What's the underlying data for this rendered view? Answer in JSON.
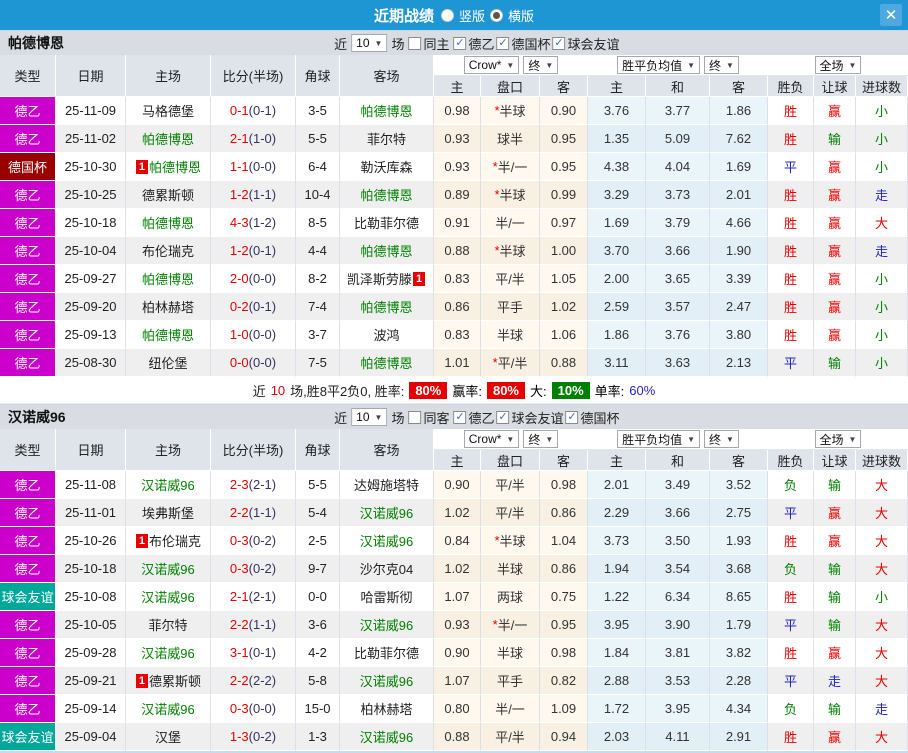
{
  "titlebar": {
    "title": "近期战绩",
    "vertical_label": "竖版",
    "horizontal_label": "横版",
    "horizontal_selected": true,
    "close_label": "✕"
  },
  "colors": {
    "accent_blue": "#1E96D3",
    "league": {
      "德乙": "#CC00CC",
      "德国杯": "#990000",
      "球会友谊": "#00A79B"
    },
    "outcome": {
      "胜": "#E60000",
      "平": "#2222CC",
      "负": "#008000",
      "赢": "#E60000",
      "输": "#008000",
      "走": "#2222CC",
      "大": "#E60000",
      "小": "#008000"
    },
    "self_team_green": "#008000",
    "score_red": "#E60000"
  },
  "header": {
    "type": "类型",
    "date": "日期",
    "home": "主场",
    "score": "比分(半场)",
    "corner": "角球",
    "away": "客场",
    "bookmaker_select": "Crow*",
    "odds_final_select": "终",
    "avg_select": "胜平负均值",
    "avg_final_select": "终",
    "scope_select": "全场",
    "sub": {
      "h": "主",
      "handicap": "盘口",
      "a": "客",
      "avg_h": "主",
      "avg_d": "和",
      "avg_a": "客",
      "wl": "胜负",
      "ah": "让球",
      "goals": "进球数"
    }
  },
  "sections": [
    {
      "team": "帕德博恩",
      "near_label": "近",
      "count_value": "10",
      "games_label": "场",
      "same_label": "同主",
      "same_checked": false,
      "filters": [
        {
          "label": "德乙",
          "checked": true
        },
        {
          "label": "德国杯",
          "checked": true
        },
        {
          "label": "球会友谊",
          "checked": true
        }
      ],
      "rows": [
        {
          "league": "德乙",
          "date": "25-11-09",
          "home": {
            "name": "马格德堡"
          },
          "score": "0-1",
          "half": "(0-1)",
          "corner": "3-5",
          "away": {
            "name": "帕德博恩",
            "self": true
          },
          "odds": [
            "0.98",
            "*半球",
            "0.90"
          ],
          "avg": [
            "3.76",
            "3.77",
            "1.86"
          ],
          "res": [
            "胜",
            "赢",
            "小"
          ]
        },
        {
          "league": "德乙",
          "date": "25-11-02",
          "home": {
            "name": "帕德博恩",
            "self": true
          },
          "score": "2-1",
          "half": "(1-0)",
          "corner": "5-5",
          "away": {
            "name": "菲尔特"
          },
          "odds": [
            "0.93",
            "球半",
            "0.95"
          ],
          "avg": [
            "1.35",
            "5.09",
            "7.62"
          ],
          "res": [
            "胜",
            "输",
            "小"
          ]
        },
        {
          "league": "德国杯",
          "date": "25-10-30",
          "home": {
            "name": "帕德博恩",
            "self": true,
            "badge": "1"
          },
          "score": "1-1",
          "half": "(0-0)",
          "corner": "6-4",
          "away": {
            "name": "勒沃库森"
          },
          "odds": [
            "0.93",
            "*半/一",
            "0.95"
          ],
          "avg": [
            "4.38",
            "4.04",
            "1.69"
          ],
          "res": [
            "平",
            "赢",
            "小"
          ]
        },
        {
          "league": "德乙",
          "date": "25-10-25",
          "home": {
            "name": "德累斯顿"
          },
          "score": "1-2",
          "half": "(1-1)",
          "corner": "10-4",
          "away": {
            "name": "帕德博恩",
            "self": true
          },
          "odds": [
            "0.89",
            "*半球",
            "0.99"
          ],
          "avg": [
            "3.29",
            "3.73",
            "2.01"
          ],
          "res": [
            "胜",
            "赢",
            "走"
          ]
        },
        {
          "league": "德乙",
          "date": "25-10-18",
          "home": {
            "name": "帕德博恩",
            "self": true
          },
          "score": "4-3",
          "half": "(1-2)",
          "corner": "8-5",
          "away": {
            "name": "比勒菲尔德"
          },
          "odds": [
            "0.91",
            "半/一",
            "0.97"
          ],
          "avg": [
            "1.69",
            "3.79",
            "4.66"
          ],
          "res": [
            "胜",
            "赢",
            "大"
          ]
        },
        {
          "league": "德乙",
          "date": "25-10-04",
          "home": {
            "name": "布伦瑞克"
          },
          "score": "1-2",
          "half": "(0-1)",
          "corner": "4-4",
          "away": {
            "name": "帕德博恩",
            "self": true
          },
          "odds": [
            "0.88",
            "*半球",
            "1.00"
          ],
          "avg": [
            "3.70",
            "3.66",
            "1.90"
          ],
          "res": [
            "胜",
            "赢",
            "走"
          ]
        },
        {
          "league": "德乙",
          "date": "25-09-27",
          "home": {
            "name": "帕德博恩",
            "self": true
          },
          "score": "2-0",
          "half": "(0-0)",
          "corner": "8-2",
          "away": {
            "name": "凯泽斯劳滕",
            "badge": "1",
            "badge_after": true
          },
          "odds": [
            "0.83",
            "平/半",
            "1.05"
          ],
          "avg": [
            "2.00",
            "3.65",
            "3.39"
          ],
          "res": [
            "胜",
            "赢",
            "小"
          ]
        },
        {
          "league": "德乙",
          "date": "25-09-20",
          "home": {
            "name": "柏林赫塔"
          },
          "score": "0-2",
          "half": "(0-1)",
          "corner": "7-4",
          "away": {
            "name": "帕德博恩",
            "self": true
          },
          "odds": [
            "0.86",
            "平手",
            "1.02"
          ],
          "avg": [
            "2.59",
            "3.57",
            "2.47"
          ],
          "res": [
            "胜",
            "赢",
            "小"
          ]
        },
        {
          "league": "德乙",
          "date": "25-09-13",
          "home": {
            "name": "帕德博恩",
            "self": true
          },
          "score": "1-0",
          "half": "(0-0)",
          "corner": "3-7",
          "away": {
            "name": "波鸿"
          },
          "odds": [
            "0.83",
            "半球",
            "1.06"
          ],
          "avg": [
            "1.86",
            "3.76",
            "3.80"
          ],
          "res": [
            "胜",
            "赢",
            "小"
          ]
        },
        {
          "league": "德乙",
          "date": "25-08-30",
          "home": {
            "name": "纽伦堡"
          },
          "score": "0-0",
          "half": "(0-0)",
          "corner": "7-5",
          "away": {
            "name": "帕德博恩",
            "self": true
          },
          "odds": [
            "1.01",
            "*平/半",
            "0.88"
          ],
          "avg": [
            "3.11",
            "3.63",
            "2.13"
          ],
          "res": [
            "平",
            "输",
            "小"
          ]
        }
      ],
      "stats": {
        "lead": [
          [
            "近",
            "#222222"
          ],
          [
            "10",
            "#E60000"
          ],
          [
            "场,胜8平2负0, 胜率:",
            "#222222"
          ]
        ],
        "badges": [
          {
            "label": "",
            "value": "80%",
            "bg": "#E60000",
            "color": "#FFFFFF"
          },
          {
            "label": "赢率:",
            "value": "80%",
            "bg": "#E60000",
            "color": "#FFFFFF"
          },
          {
            "label": "大:",
            "value": "10%",
            "bg": "#008000",
            "color": "#FFFFFF"
          },
          {
            "label": "单率:",
            "value": "60%",
            "bg": "",
            "color": "#2222CC"
          }
        ]
      }
    },
    {
      "team": "汉诺威96",
      "near_label": "近",
      "count_value": "10",
      "games_label": "场",
      "same_label": "同客",
      "same_checked": false,
      "filters": [
        {
          "label": "德乙",
          "checked": true
        },
        {
          "label": "球会友谊",
          "checked": true
        },
        {
          "label": "德国杯",
          "checked": true
        }
      ],
      "rows": [
        {
          "league": "德乙",
          "date": "25-11-08",
          "home": {
            "name": "汉诺威96",
            "self": true
          },
          "score": "2-3",
          "half": "(2-1)",
          "corner": "5-5",
          "away": {
            "name": "达姆施塔特"
          },
          "odds": [
            "0.90",
            "平/半",
            "0.98"
          ],
          "avg": [
            "2.01",
            "3.49",
            "3.52"
          ],
          "res": [
            "负",
            "输",
            "大"
          ]
        },
        {
          "league": "德乙",
          "date": "25-11-01",
          "home": {
            "name": "埃弗斯堡"
          },
          "score": "2-2",
          "half": "(1-1)",
          "corner": "5-4",
          "away": {
            "name": "汉诺威96",
            "self": true
          },
          "odds": [
            "1.02",
            "平/半",
            "0.86"
          ],
          "avg": [
            "2.29",
            "3.66",
            "2.75"
          ],
          "res": [
            "平",
            "赢",
            "大"
          ]
        },
        {
          "league": "德乙",
          "date": "25-10-26",
          "home": {
            "name": "布伦瑞克",
            "badge": "1"
          },
          "score": "0-3",
          "half": "(0-2)",
          "corner": "2-5",
          "away": {
            "name": "汉诺威96",
            "self": true
          },
          "odds": [
            "0.84",
            "*半球",
            "1.04"
          ],
          "avg": [
            "3.73",
            "3.50",
            "1.93"
          ],
          "res": [
            "胜",
            "赢",
            "大"
          ]
        },
        {
          "league": "德乙",
          "date": "25-10-18",
          "home": {
            "name": "汉诺威96",
            "self": true
          },
          "score": "0-3",
          "half": "(0-2)",
          "corner": "9-7",
          "away": {
            "name": "沙尔克04"
          },
          "odds": [
            "1.02",
            "半球",
            "0.86"
          ],
          "avg": [
            "1.94",
            "3.54",
            "3.68"
          ],
          "res": [
            "负",
            "输",
            "大"
          ]
        },
        {
          "league": "球会友谊",
          "date": "25-10-08",
          "home": {
            "name": "汉诺威96",
            "self": true
          },
          "score": "2-1",
          "half": "(2-1)",
          "corner": "0-0",
          "away": {
            "name": "哈雷斯彻"
          },
          "odds": [
            "1.07",
            "两球",
            "0.75"
          ],
          "avg": [
            "1.22",
            "6.34",
            "8.65"
          ],
          "res": [
            "胜",
            "输",
            "小"
          ]
        },
        {
          "league": "德乙",
          "date": "25-10-05",
          "home": {
            "name": "菲尔特"
          },
          "score": "2-2",
          "half": "(1-1)",
          "corner": "3-6",
          "away": {
            "name": "汉诺威96",
            "self": true
          },
          "odds": [
            "0.93",
            "*半/一",
            "0.95"
          ],
          "avg": [
            "3.95",
            "3.90",
            "1.79"
          ],
          "res": [
            "平",
            "输",
            "大"
          ]
        },
        {
          "league": "德乙",
          "date": "25-09-28",
          "home": {
            "name": "汉诺威96",
            "self": true
          },
          "score": "3-1",
          "half": "(0-1)",
          "corner": "4-2",
          "away": {
            "name": "比勒菲尔德"
          },
          "odds": [
            "0.90",
            "半球",
            "0.98"
          ],
          "avg": [
            "1.84",
            "3.81",
            "3.82"
          ],
          "res": [
            "胜",
            "赢",
            "大"
          ]
        },
        {
          "league": "德乙",
          "date": "25-09-21",
          "home": {
            "name": "德累斯顿",
            "badge": "1"
          },
          "score": "2-2",
          "half": "(2-2)",
          "corner": "5-8",
          "away": {
            "name": "汉诺威96",
            "self": true
          },
          "odds": [
            "1.07",
            "平手",
            "0.82"
          ],
          "avg": [
            "2.88",
            "3.53",
            "2.28"
          ],
          "res": [
            "平",
            "走",
            "大"
          ]
        },
        {
          "league": "德乙",
          "date": "25-09-14",
          "home": {
            "name": "汉诺威96",
            "self": true
          },
          "score": "0-3",
          "half": "(0-0)",
          "corner": "15-0",
          "away": {
            "name": "柏林赫塔"
          },
          "odds": [
            "0.80",
            "半/一",
            "1.09"
          ],
          "avg": [
            "1.72",
            "3.95",
            "4.34"
          ],
          "res": [
            "负",
            "输",
            "走"
          ]
        },
        {
          "league": "球会友谊",
          "date": "25-09-04",
          "home": {
            "name": "汉堡"
          },
          "score": "1-3",
          "half": "(0-2)",
          "corner": "1-3",
          "away": {
            "name": "汉诺威96",
            "self": true
          },
          "odds": [
            "0.88",
            "平/半",
            "0.94"
          ],
          "avg": [
            "2.03",
            "4.11",
            "2.91"
          ],
          "res": [
            "胜",
            "赢",
            "大"
          ]
        }
      ],
      "stats": null
    }
  ]
}
